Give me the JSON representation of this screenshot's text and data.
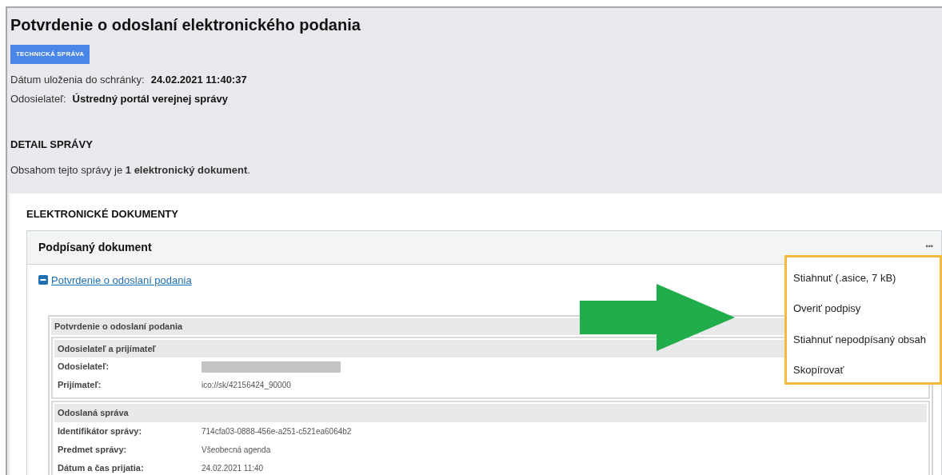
{
  "title": "Potvrdenie o odoslaní elektronického podania",
  "badge": "TECHNICKÁ SPRÁVA",
  "meta": [
    {
      "label": "Dátum uloženia do schránky:",
      "value": "24.02.2021 11:40:37"
    },
    {
      "label": "Odosielateľ:",
      "value": "Ústredný portál verejnej správy"
    }
  ],
  "detail_heading": "DETAIL SPRÁVY",
  "detail_text": "Obsahom tejto správy je **1 elektronický dokument**.",
  "documents_heading": "ELEKTRONICKÉ DOKUMENTY",
  "card": {
    "title": "Podpísaný dokument",
    "menu_icon": "•••",
    "expanded": true,
    "link": "Potvrdenie o odoslaní podania",
    "document": {
      "title": "Potvrdenie o odoslaní podania",
      "sections": [
        {
          "title": "Odosielateľ a prijímateľ",
          "rows": [
            {
              "kind": "redacted",
              "label": "Odosielateľ:"
            },
            {
              "kind": "text",
              "label": "Prijímateľ:",
              "value": "ico://sk/42156424_90000"
            }
          ]
        },
        {
          "title": "Odoslaná správa",
          "rows": [
            {
              "kind": "text",
              "label": "Identifikátor správy:",
              "value": "714cfa03-0888-456e-a251-c521ea6064b2"
            },
            {
              "kind": "text",
              "label": "Predmet správy:",
              "value": "Všeobecná agenda"
            },
            {
              "kind": "text",
              "label": "Dátum a čas prijatia:",
              "value": "24.02.2021 11:40"
            }
          ]
        }
      ]
    }
  },
  "menu": [
    "Stiahnuť (.asice, 7 kB)",
    "Overiť podpisy",
    "Stiahnuť nepodpísaný obsah",
    "Skopírovať"
  ]
}
